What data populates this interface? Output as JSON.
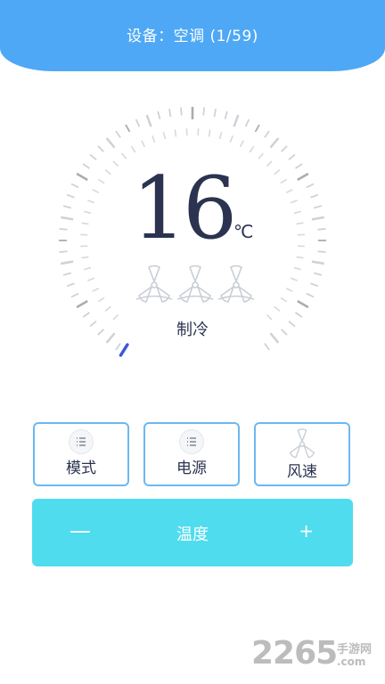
{
  "header": {
    "title": "设备：空调 (1/59)"
  },
  "thermostat": {
    "temperature": "16",
    "unit": "℃",
    "mode": "制冷",
    "fan_level": 3,
    "fan_icon": "fan-icon"
  },
  "buttons": [
    {
      "label": "模式",
      "icon": "list-icon"
    },
    {
      "label": "电源",
      "icon": "list-icon"
    },
    {
      "label": "风速",
      "icon": "fan-icon"
    }
  ],
  "temp_control": {
    "minus": "—",
    "label": "温度",
    "plus": "+"
  },
  "watermark": {
    "number": "2265",
    "site_name": "手游网",
    "url": ".com"
  },
  "colors": {
    "header": "#4ea8f5",
    "temp_bar": "#4fdcee",
    "button_border": "#6cb8f2",
    "text": "#2b3350"
  }
}
